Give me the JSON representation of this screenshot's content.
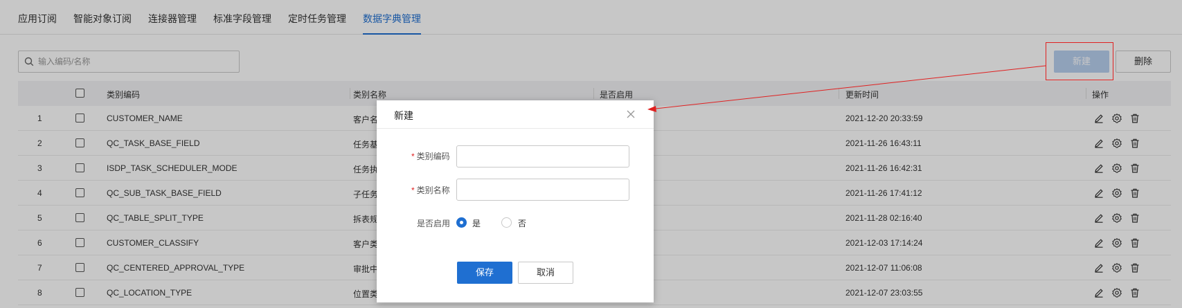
{
  "tabs": [
    {
      "label": "应用订阅",
      "active": false
    },
    {
      "label": "智能对象订阅",
      "active": false
    },
    {
      "label": "连接器管理",
      "active": false
    },
    {
      "label": "标准字段管理",
      "active": false
    },
    {
      "label": "定时任务管理",
      "active": false
    },
    {
      "label": "数据字典管理",
      "active": true
    }
  ],
  "toolbar": {
    "search_placeholder": "输入编码/名称",
    "new_label": "新建",
    "delete_label": "删除"
  },
  "table": {
    "headers": {
      "code": "类别编码",
      "name": "类别名称",
      "enabled": "是否启用",
      "updated": "更新时间",
      "actions": "操作"
    },
    "rows": [
      {
        "no": "1",
        "code": "CUSTOMER_NAME",
        "name": "客户名",
        "updated": "2021-12-20 20:33:59"
      },
      {
        "no": "2",
        "code": "QC_TASK_BASE_FIELD",
        "name": "任务基",
        "updated": "2021-11-26 16:43:11"
      },
      {
        "no": "3",
        "code": "ISDP_TASK_SCHEDULER_MODE",
        "name": "任务执",
        "updated": "2021-11-26 16:42:31"
      },
      {
        "no": "4",
        "code": "QC_SUB_TASK_BASE_FIELD",
        "name": "子任务",
        "updated": "2021-11-26 17:41:12"
      },
      {
        "no": "5",
        "code": "QC_TABLE_SPLIT_TYPE",
        "name": "拆表规",
        "updated": "2021-11-28 02:16:40"
      },
      {
        "no": "6",
        "code": "CUSTOMER_CLASSIFY",
        "name": "客户类",
        "updated": "2021-12-03 17:14:24"
      },
      {
        "no": "7",
        "code": "QC_CENTERED_APPROVAL_TYPE",
        "name": "审批中",
        "updated": "2021-12-07 11:06:08"
      },
      {
        "no": "8",
        "code": "QC_LOCATION_TYPE",
        "name": "位置类",
        "updated": "2021-12-07 23:03:55"
      }
    ]
  },
  "dialog": {
    "title": "新建",
    "code_label": "类别编码",
    "name_label": "类别名称",
    "enabled_label": "是否启用",
    "required_mark": "*",
    "yes_label": "是",
    "no_label": "否",
    "save_label": "保存",
    "cancel_label": "取消"
  },
  "icons": {
    "search": "search-icon",
    "edit": "edit-icon",
    "settings": "gear-icon",
    "delete": "trash-icon",
    "close": "close-icon"
  },
  "colors": {
    "accent": "#1f6fd1",
    "annotation": "#e02020"
  }
}
